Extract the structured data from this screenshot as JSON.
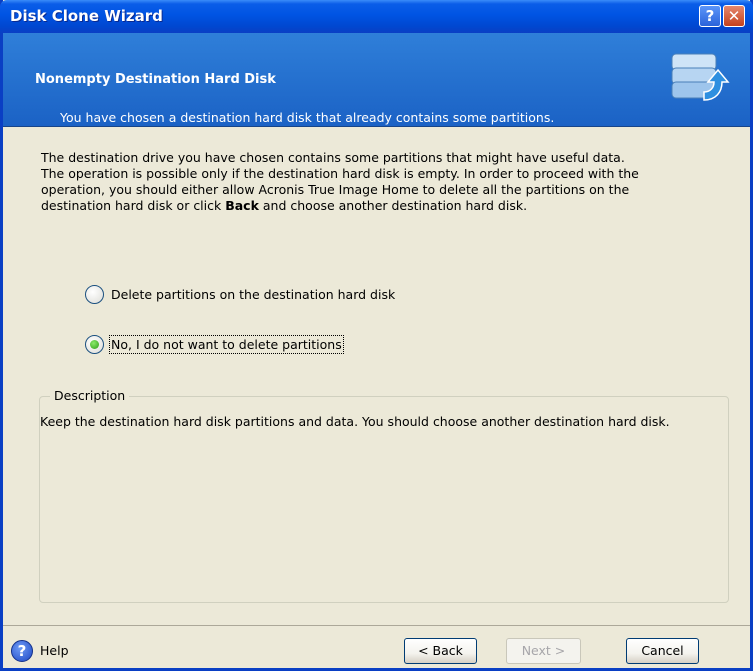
{
  "window": {
    "title": "Disk Clone Wizard",
    "help_glyph": "?",
    "close_glyph": "✕"
  },
  "header": {
    "title": "Nonempty Destination Hard Disk",
    "subtitle": "You have chosen a destination hard disk that already contains some partitions.",
    "icon": "disk-clone-icon"
  },
  "body": {
    "line1": "The destination drive you have chosen contains some partitions that might have useful data.",
    "line2": "The operation is possible only if the destination hard disk is empty. In order to proceed with the",
    "line3": "operation, you should either allow Acronis True Image Home to delete all the partitions on the",
    "line4_pre": "destination hard disk or click ",
    "line4_bold": "Back",
    "line4_post": " and choose another destination hard disk."
  },
  "options": [
    {
      "label": "Delete partitions on the destination hard disk",
      "checked": false
    },
    {
      "label": "No, I do not want to delete partitions",
      "checked": true
    }
  ],
  "description": {
    "legend": "Description",
    "text": "Keep the destination hard disk partitions and data. You should choose another destination hard disk."
  },
  "footer": {
    "help_label": "Help",
    "back_label": "< Back",
    "next_label": "Next >",
    "cancel_label": "Cancel"
  },
  "colors": {
    "titlebar": "#0054E3",
    "header": "#1B62C5",
    "dialog": "#ECE9D8"
  }
}
